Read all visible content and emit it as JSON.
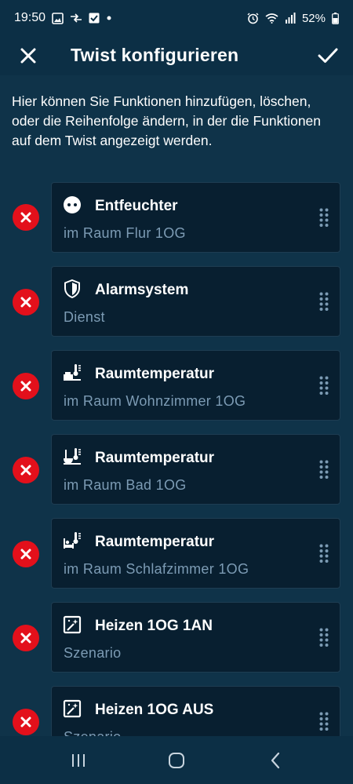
{
  "status_bar": {
    "time": "19:50",
    "battery": "52%"
  },
  "app_bar": {
    "title": "Twist konfigurieren"
  },
  "description": "Hier können Sie Funktionen hinzufügen, löschen, oder die Reihenfolge ändern, in der die Funktionen auf dem Twist angezeigt werden.",
  "items": [
    {
      "icon": "plug-icon",
      "title": "Entfeuchter",
      "subtitle": "im Raum Flur 1OG"
    },
    {
      "icon": "shield-icon",
      "title": "Alarmsystem",
      "subtitle": "Dienst"
    },
    {
      "icon": "thermostat-sofa-icon",
      "title": "Raumtemperatur",
      "subtitle": "im Raum Wohnzimmer 1OG"
    },
    {
      "icon": "thermostat-bath-icon",
      "title": "Raumtemperatur",
      "subtitle": "im Raum Bad 1OG"
    },
    {
      "icon": "thermostat-bed-icon",
      "title": "Raumtemperatur",
      "subtitle": "im Raum Schlafzimmer 1OG"
    },
    {
      "icon": "scenario-icon",
      "title": "Heizen 1OG 1AN",
      "subtitle": "Szenario"
    },
    {
      "icon": "scenario-icon",
      "title": "Heizen 1OG AUS",
      "subtitle": "Szenario"
    }
  ],
  "colors": {
    "background": "#0f3349",
    "bar": "#0c2f45",
    "card": "#081f30",
    "remove": "#e3101b",
    "subtitle": "#7c9bb4"
  }
}
